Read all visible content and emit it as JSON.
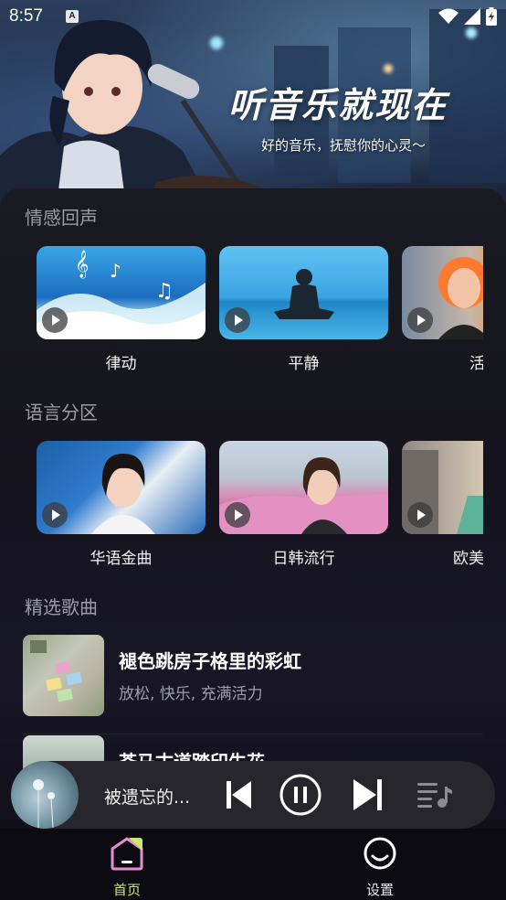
{
  "status_bar": {
    "time": "8:57",
    "notification_icon": "A"
  },
  "banner": {
    "title": "听音乐就现在",
    "subtitle": "好的音乐，抚慰你的心灵～"
  },
  "sections": {
    "emotion": {
      "title": "情感回声",
      "cards": [
        {
          "label": "律动"
        },
        {
          "label": "平静"
        },
        {
          "label": "活"
        }
      ]
    },
    "language": {
      "title": "语言分区",
      "cards": [
        {
          "label": "华语金曲"
        },
        {
          "label": "日韩流行"
        },
        {
          "label": "欧美"
        }
      ]
    },
    "featured": {
      "title": "精选歌曲",
      "songs": [
        {
          "title": "褪色跳房子格里的彩虹",
          "tags": "放松, 快乐, 充满活力"
        },
        {
          "title": "苍马古道踏印生花",
          "tags": ""
        }
      ]
    }
  },
  "player": {
    "title": "被遗忘的...",
    "icons": [
      "previous-icon",
      "pause-icon",
      "next-icon",
      "playlist-icon"
    ]
  },
  "bottom_nav": {
    "items": [
      {
        "label": "首页",
        "icon": "home-icon",
        "active": true
      },
      {
        "label": "设置",
        "icon": "settings-icon",
        "active": false
      }
    ]
  },
  "colors": {
    "accent": "#c9e86a",
    "section_title": "#9b9ca5",
    "panel_bg": "#191a22",
    "player_bg": "#26262c"
  }
}
